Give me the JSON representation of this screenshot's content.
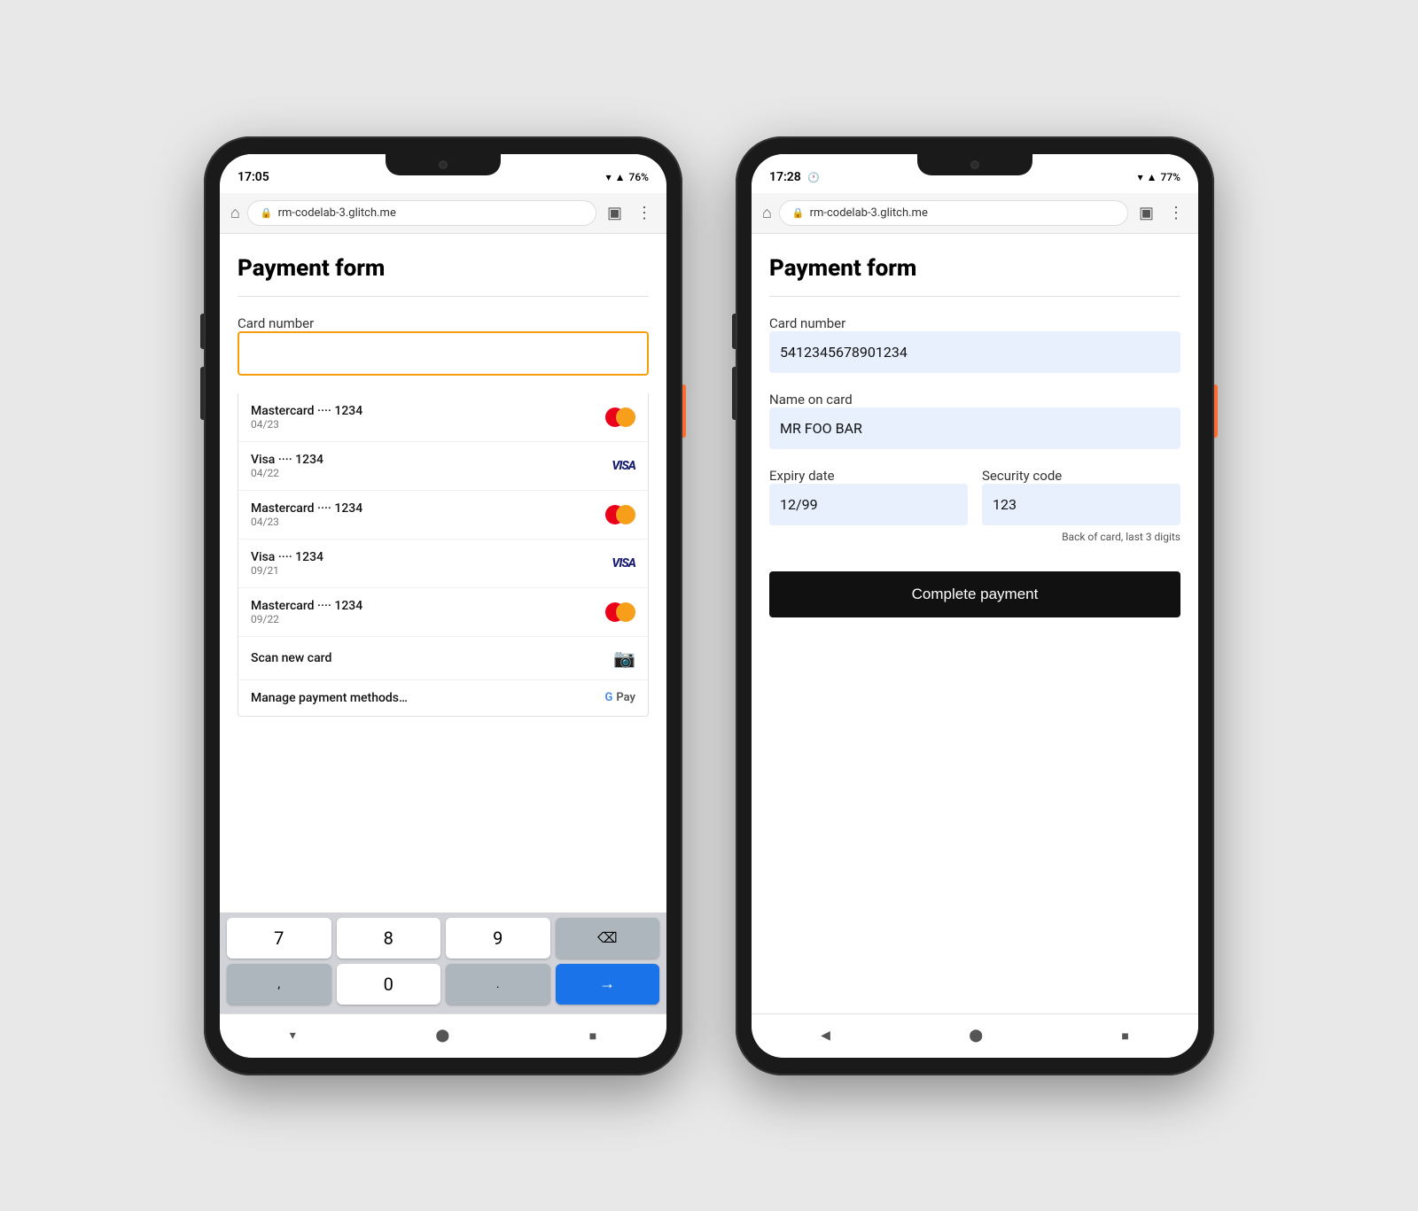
{
  "phones": [
    {
      "id": "left-phone",
      "status": {
        "time": "17:05",
        "battery": "76%",
        "hasClockIcon": false
      },
      "browser": {
        "url": "rm-codelab-3.glitch.me"
      },
      "page": {
        "title": "Payment form",
        "cardNumberLabel": "Card number",
        "cardNumberPlaceholder": "",
        "suggestions": [
          {
            "brand": "Mastercard",
            "dots": "••••",
            "last4": "1234",
            "expiry": "04/23",
            "logoType": "mastercard"
          },
          {
            "brand": "Visa",
            "dots": "••••",
            "last4": "1234",
            "expiry": "04/22",
            "logoType": "visa"
          },
          {
            "brand": "Mastercard",
            "dots": "••••",
            "last4": "1234",
            "expiry": "04/23",
            "logoType": "mastercard"
          },
          {
            "brand": "Visa",
            "dots": "••••",
            "last4": "1234",
            "expiry": "09/21",
            "logoType": "visa"
          },
          {
            "brand": "Mastercard",
            "dots": "••••",
            "last4": "1234",
            "expiry": "09/22",
            "logoType": "mastercard"
          }
        ],
        "scanLabel": "Scan new card",
        "manageLabel": "Manage payment methods…"
      },
      "keyboard": {
        "rows": [
          [
            "7",
            "8",
            "9",
            "⌫"
          ],
          [
            ",",
            "0",
            ".",
            "→"
          ]
        ]
      }
    },
    {
      "id": "right-phone",
      "status": {
        "time": "17:28",
        "battery": "77%",
        "hasClockIcon": true
      },
      "browser": {
        "url": "rm-codelab-3.glitch.me"
      },
      "page": {
        "title": "Payment form",
        "cardNumberLabel": "Card number",
        "cardNumberValue": "5412345678901234",
        "nameOnCardLabel": "Name on card",
        "nameOnCardValue": "MR FOO BAR",
        "expiryLabel": "Expiry date",
        "expiryValue": "12/99",
        "securityCodeLabel": "Security code",
        "securityCodeValue": "123",
        "securityHint": "Back of card, last 3 digits",
        "completeButtonLabel": "Complete payment"
      }
    }
  ]
}
